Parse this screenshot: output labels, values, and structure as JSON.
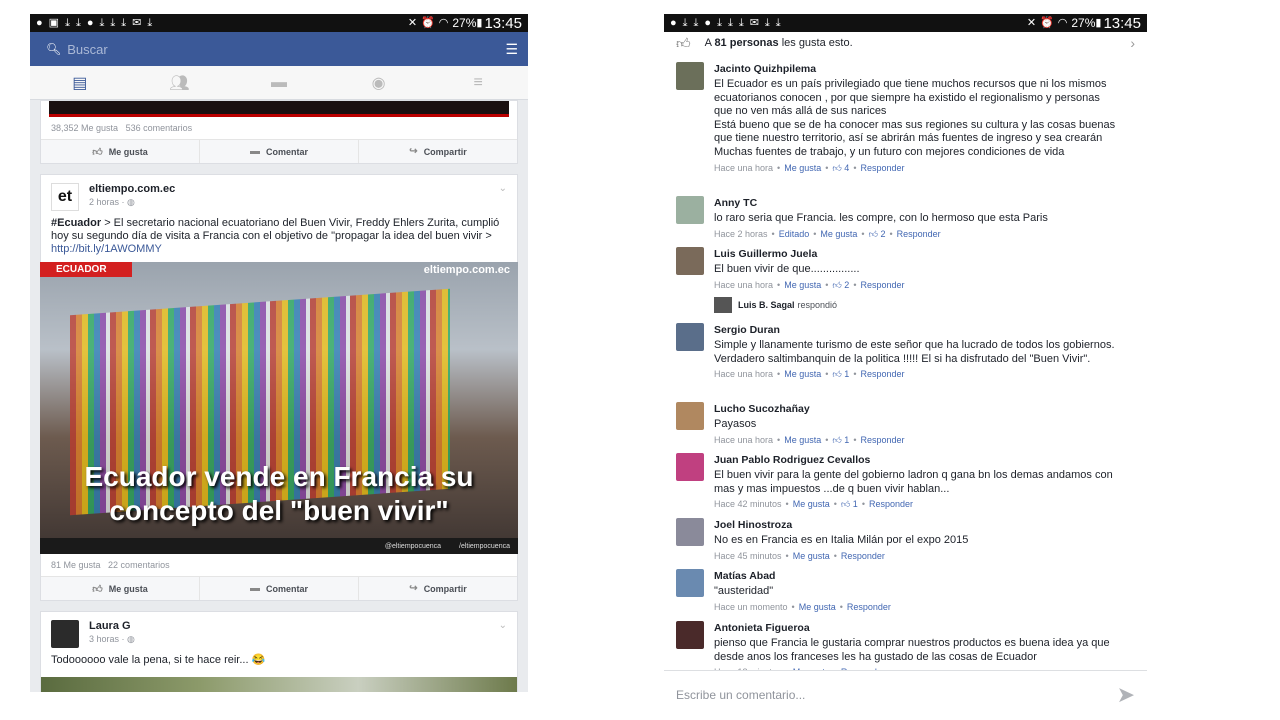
{
  "status_bar": {
    "battery": "27%",
    "time": "13:45"
  },
  "left": {
    "search_placeholder": "Buscar",
    "post1": {
      "stats_likes": "38,352 Me gusta",
      "stats_comments": "536 comentarios"
    },
    "actions": {
      "like": "Me gusta",
      "comment": "Comentar",
      "share": "Compartir"
    },
    "post2": {
      "author": "eltiempo.com.ec",
      "time": "2 horas",
      "tag": "#Ecuador",
      "text": " > El secretario nacional ecuatoriano del Buen Vivir, Freddy Ehlers Zurita, cumplió hoy su segundo día de visita a Francia con el objetivo de \"propagar la idea del buen vivir  > ",
      "link": "http://bit.ly/1AWOMMY",
      "image_ribbon": "ECUADOR",
      "image_brand": "eltiempo.com.ec",
      "image_title": "Ecuador vende en Francia su concepto del \"buen vivir\"",
      "image_footer_left": "@eltiempocuenca",
      "image_footer_right": "/eltiempocuenca",
      "stats_likes": "81 Me gusta",
      "stats_comments": "22 comentarios"
    },
    "post3": {
      "author": "Laura G",
      "time": "3 horas",
      "text": "Todoooooo vale la pena, si te hace reir... 😂"
    }
  },
  "right": {
    "likes_prefix": "A ",
    "likes_count": "81 personas",
    "likes_suffix": " les gusta esto.",
    "comments": [
      {
        "author": "Jacinto Quizhpilema",
        "text": "El Ecuador es un país privilegiado que tiene muchos recursos que ni los mismos ecuatorianos conocen , por que siempre ha existido el regionalismo y personas que no ven más allá de sus narices\nEstá bueno que se de ha conocer mas sus regiones su cultura y las cosas buenas que tiene nuestro territorio, así se abrirán más fuentes de ingreso y sea crearán Muchas fuentes de trabajo, y un futuro con mejores condiciones de vida",
        "time": "Hace una hora",
        "edited": "",
        "likes": "4"
      },
      {
        "author": "Anny TC",
        "text": "lo raro seria que Francia. les compre, con lo hermoso que esta Paris",
        "time": "Hace 2 horas",
        "edited": "Editado",
        "likes": "2"
      },
      {
        "author": "Luis Guillermo Juela",
        "text": "El buen vivir de que................",
        "time": "Hace una hora",
        "edited": "",
        "likes": "2",
        "reply_author": "Luis B. Sagal",
        "reply_text": "respondió"
      },
      {
        "author": "Sergio Duran",
        "text": "Simple y llanamente turismo de este señor que ha lucrado de todos los gobiernos. Verdadero saltimbanquin de la politica !!!!! El si ha disfrutado del \"Buen Vivir\".",
        "time": "Hace una hora",
        "edited": "",
        "likes": "1"
      },
      {
        "author": "Lucho Sucozhañay",
        "text": "Payasos",
        "time": "Hace una hora",
        "edited": "",
        "likes": "1"
      },
      {
        "author": "Juan Pablo Rodriguez Cevallos",
        "text": "El buen vivir para la gente del gobierno ladron q gana bn los demas andamos con mas y mas impuestos ...de q buen vivir hablan...",
        "time": "Hace 42 minutos",
        "edited": "",
        "likes": "1"
      },
      {
        "author": "Joel Hinostroza",
        "text": "No es en Francia es en Italia Milán por el expo 2015",
        "time": "Hace 45 minutos",
        "edited": "",
        "likes": ""
      },
      {
        "author": "Matías Abad",
        "text": "\"austeridad\"",
        "time": "Hace un momento",
        "edited": "",
        "likes": ""
      },
      {
        "author": "Antonieta Figueroa",
        "text": "pienso que Francia le gustaria comprar nuestros productos es buena idea ya que desde anos los franceses les ha gustado de las cosas de Ecuador",
        "time": "Hace 18 minutos",
        "edited": "",
        "likes": ""
      }
    ],
    "meta_like": "Me gusta",
    "meta_reply": "Responder",
    "composer_placeholder": "Escribe un comentario..."
  }
}
